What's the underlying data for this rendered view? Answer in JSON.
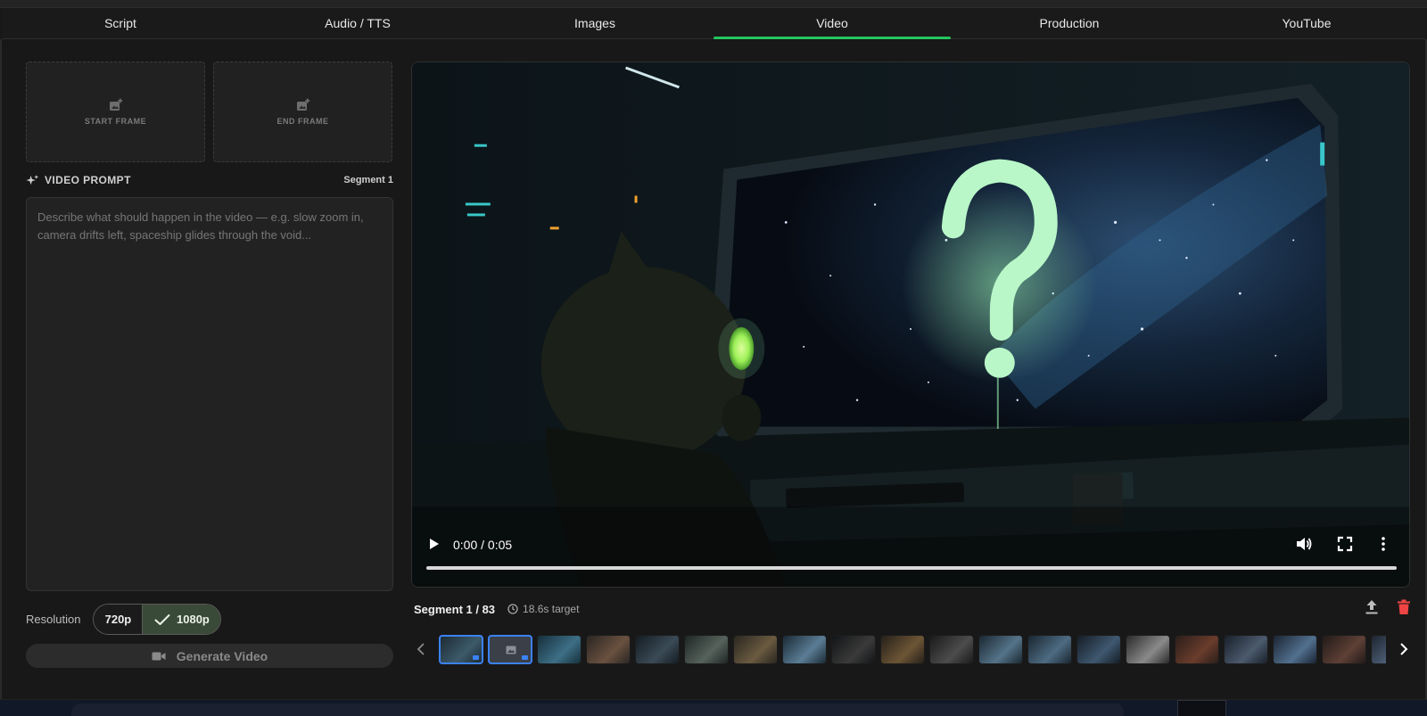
{
  "tabs": [
    {
      "label": "Script"
    },
    {
      "label": "Audio / TTS"
    },
    {
      "label": "Images"
    },
    {
      "label": "Video",
      "active": true
    },
    {
      "label": "Production"
    },
    {
      "label": "YouTube"
    }
  ],
  "frames": {
    "start_label": "START FRAME",
    "end_label": "END FRAME",
    "icon": "add-image-icon"
  },
  "video_prompt": {
    "title": "VIDEO PROMPT",
    "title_icon": "sparkle-icon",
    "segment_label": "Segment 1",
    "placeholder": "Describe what should happen in the video — e.g. slow zoom in, camera drifts left, spaceship glides through the void...",
    "value": ""
  },
  "resolution": {
    "label": "Resolution",
    "options": [
      "720p",
      "1080p"
    ],
    "selected": "1080p"
  },
  "generate": {
    "label": "Generate Video",
    "icon": "video-camera-icon"
  },
  "player": {
    "time": "0:00 / 0:05",
    "progress": 0,
    "icons": [
      "play-icon",
      "volume-icon",
      "fullscreen-icon",
      "more-vertical-icon"
    ]
  },
  "segment": {
    "title": "Segment 1 / 83",
    "target": "18.6s target",
    "target_icon": "clock-icon",
    "actions": [
      "upload-icon",
      "trash-icon"
    ]
  },
  "filmstrip": {
    "count_visible": 20,
    "selected_index": 0,
    "accent": "#3b82f6"
  },
  "colors": {
    "active_tab": "#22c55e",
    "selected_resolution": "#3a4a38",
    "delete": "#ef4444",
    "thumb_selected": "#3b82f6"
  }
}
